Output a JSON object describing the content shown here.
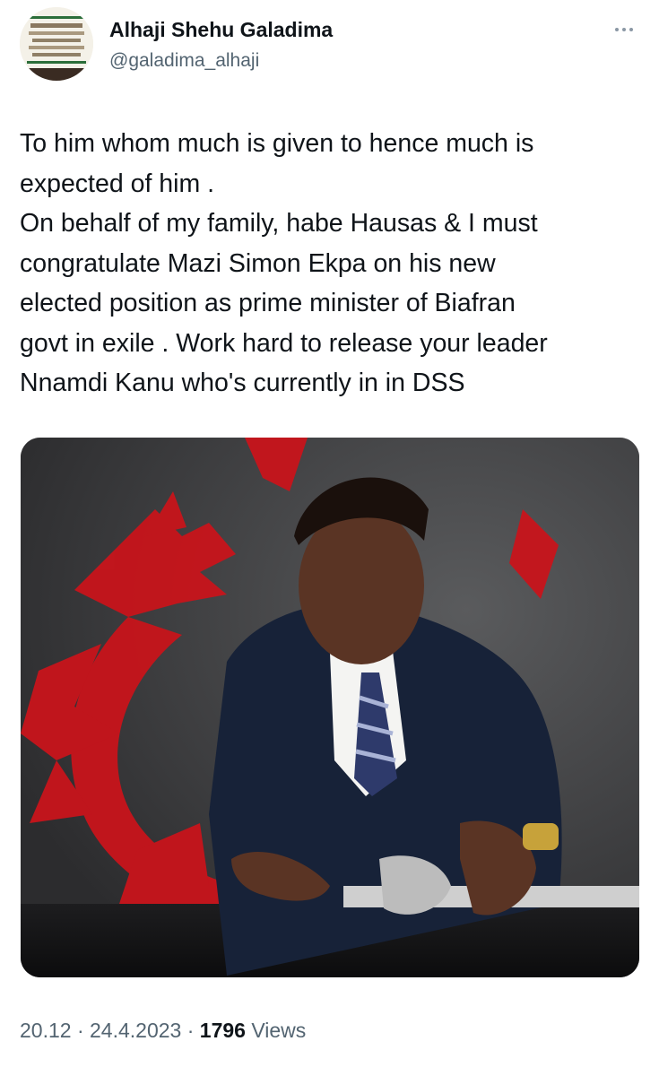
{
  "author": {
    "display_name": "Alhaji Shehu Galadima",
    "handle": "@galadima_alhaji"
  },
  "tweet": {
    "text": "To him whom much is given to hence much is\nexpected of him .\nOn behalf of my family, habe Hausas & I must\ncongratulate Mazi Simon Ekpa on his new\nelected position as prime minister of Biafran\ngovt in exile . Work hard to release your leader\nNnamdi Kanu who's currently in in DSS"
  },
  "metadata": {
    "time": "20.12",
    "separator": "·",
    "date": "24.4.2023",
    "views_count": "1796",
    "views_label": "Views"
  },
  "icons": {
    "more": "more-horizontal-icon"
  },
  "colors": {
    "secondary_text": "#536471",
    "primary_text": "#0f1419",
    "dragon_red": "#c8141b"
  }
}
